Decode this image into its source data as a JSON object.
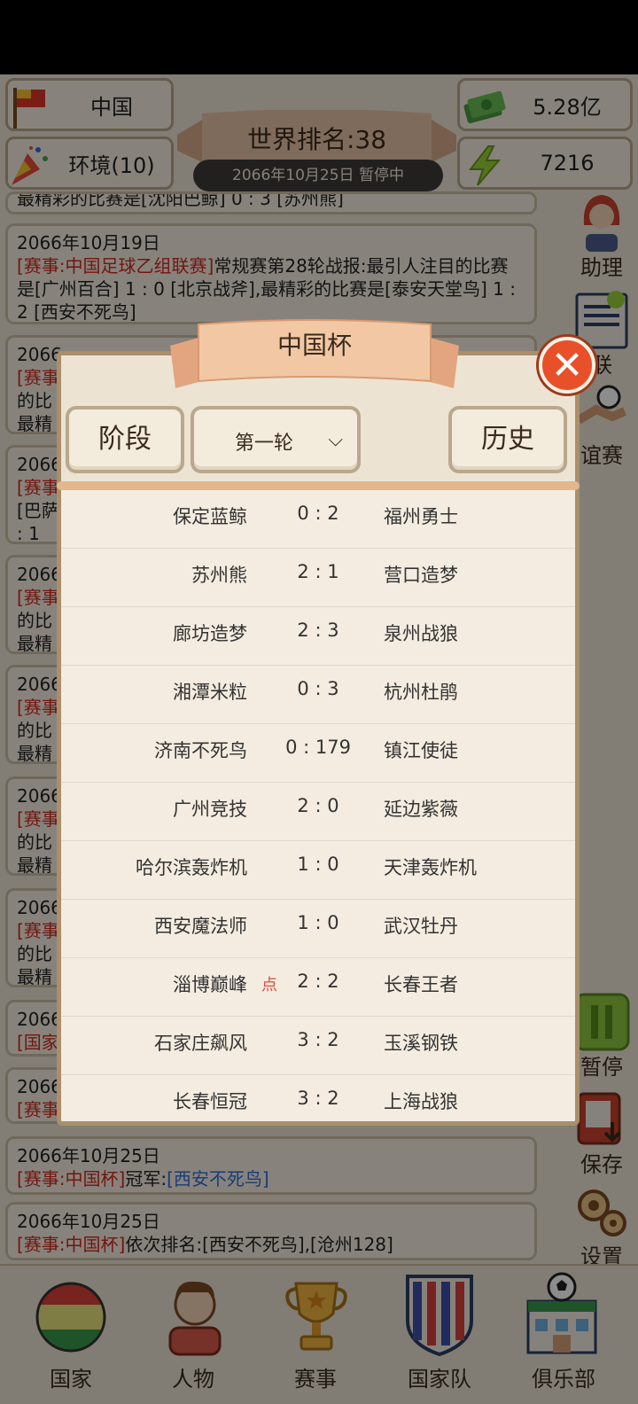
{
  "top": {
    "country": "中国",
    "environment": "环境(10)",
    "money": "5.28亿",
    "energy": "7216",
    "world_rank": "世界排名:38",
    "date_status": "2066年10月25日  暂停中"
  },
  "news": [
    {
      "date": "",
      "tag": "",
      "text": "最精彩的比赛是[沈阳巴鲸] 0 : 3 [苏州熊]"
    },
    {
      "date": "2066年10月19日",
      "tag": "[赛事:中国足球乙组联赛]",
      "text": "常规赛第28轮战报:最引人注目的比赛是[广州百合] 1 : 0 [北京战斧],最精彩的比赛是[泰安天堂鸟] 1 : 2 [西安不死鸟]"
    },
    {
      "date": "2066年10月25日",
      "tag": "[赛事:中国杯]",
      "text": "冠军:",
      "highlight": "[西安不死鸟]"
    },
    {
      "date": "2066年10月25日",
      "tag": "[赛事:中国杯]",
      "text": "依次排名:[西安不死鸟],[沧州128]"
    }
  ],
  "partial_news": [
    {
      "date": "2066",
      "tag": "[赛事",
      "lines": [
        "的比",
        "最精"
      ]
    },
    {
      "date": "2066",
      "tag": "[赛事",
      "lines": [
        "[巴萨",
        ": 1"
      ]
    },
    {
      "date": "2066",
      "tag": "[赛事",
      "lines": [
        "的比",
        "最精"
      ]
    },
    {
      "date": "2066",
      "tag": "[赛事",
      "lines": [
        "的比",
        "最精"
      ]
    },
    {
      "date": "2066",
      "tag": "[赛事",
      "lines": [
        "的比",
        "最精"
      ]
    },
    {
      "date": "2066",
      "tag": "[赛事",
      "lines": [
        "的比",
        "最精"
      ]
    },
    {
      "date": "2066",
      "tag": "[国家",
      "lines": []
    },
    {
      "date": "2066",
      "tag": "[赛事",
      "lines": []
    }
  ],
  "side": {
    "assistant": "助理",
    "league_partial": "联",
    "friendly_partial": "谊赛",
    "pause": "暂停",
    "save": "保存",
    "settings": "设置"
  },
  "nav": [
    "国家",
    "人物",
    "赛事",
    "国家队",
    "俱乐部"
  ],
  "modal": {
    "title": "中国杯",
    "stage_btn": "阶段",
    "round_select": "第一轮",
    "history_btn": "历史",
    "matches": [
      {
        "home": "保定蓝鲸",
        "score": "0  :  2",
        "away": "福州勇士",
        "pen": ""
      },
      {
        "home": "苏州熊",
        "score": "2  :  1",
        "away": "营口造梦",
        "pen": ""
      },
      {
        "home": "廊坊造梦",
        "score": "2  :  3",
        "away": "泉州战狼",
        "pen": ""
      },
      {
        "home": "湘潭米粒",
        "score": "0  :  3",
        "away": "杭州杜鹃",
        "pen": ""
      },
      {
        "home": "济南不死鸟",
        "score": "0  :  179",
        "away": "镇江使徒",
        "pen": ""
      },
      {
        "home": "广州竞技",
        "score": "2  :  0",
        "away": "延边紫薇",
        "pen": ""
      },
      {
        "home": "哈尔滨轰炸机",
        "score": "1  :  0",
        "away": "天津轰炸机",
        "pen": ""
      },
      {
        "home": "西安魔法师",
        "score": "1  :  0",
        "away": "武汉牡丹",
        "pen": ""
      },
      {
        "home": "淄博巅峰",
        "score": "2  :  2",
        "away": "长春王者",
        "pen": "点"
      },
      {
        "home": "石家庄飙风",
        "score": "3  :  2",
        "away": "玉溪钢铁",
        "pen": ""
      },
      {
        "home": "长春恒冠",
        "score": "3  :  2",
        "away": "上海战狼",
        "pen": ""
      }
    ]
  }
}
